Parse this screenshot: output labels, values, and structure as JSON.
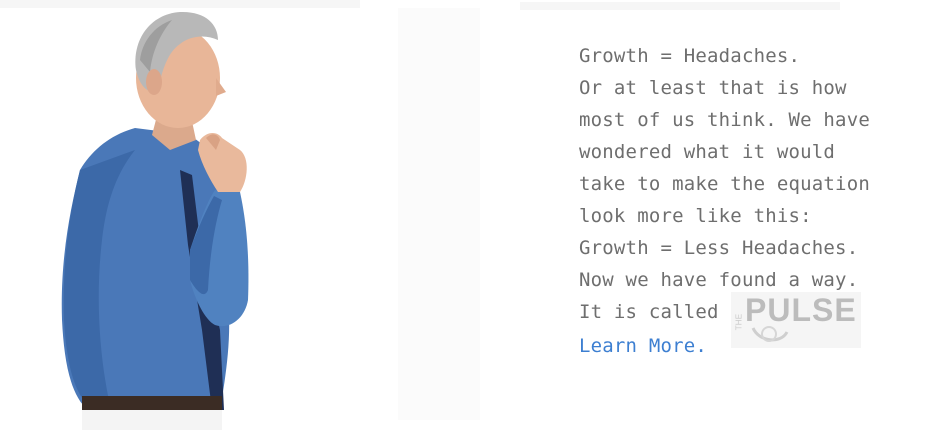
{
  "figure": {
    "subject": "man-thinking-icon"
  },
  "copy": {
    "lines": [
      "Growth = Headaches.",
      "Or at least that is  how",
      "most of us think.  We have",
      "wondered  what it would",
      "take to make the equation",
      "look more like this:",
      "Growth = Less Headaches.",
      "Now we have found a way."
    ],
    "called_prefix": "It is called",
    "link_text": "Learn More."
  },
  "logo": {
    "small_text": "THE",
    "main_text": "PULSE"
  },
  "colors": {
    "text": "#6e6e6e",
    "link": "#3d7fd1",
    "shirt": "#4a78b8",
    "background": "#ffffff"
  }
}
